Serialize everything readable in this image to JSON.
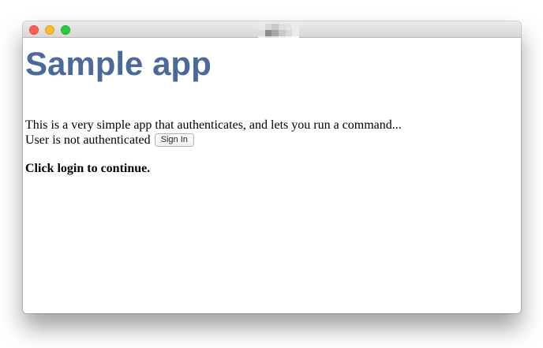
{
  "window": {
    "title_icon": "blurred-favicon",
    "traffic_lights": [
      "close",
      "minimize",
      "maximize"
    ]
  },
  "page": {
    "title": "Sample app",
    "description": "This is a very simple app that authenticates, and lets you run a command...",
    "auth_status": "User is not authenticated",
    "sign_in_label": "Sign In",
    "prompt": "Click login to continue."
  },
  "colors": {
    "title": "#4b6a9b",
    "close": "#fc5f57",
    "minimize": "#fdbc2e",
    "maximize": "#29c940"
  }
}
